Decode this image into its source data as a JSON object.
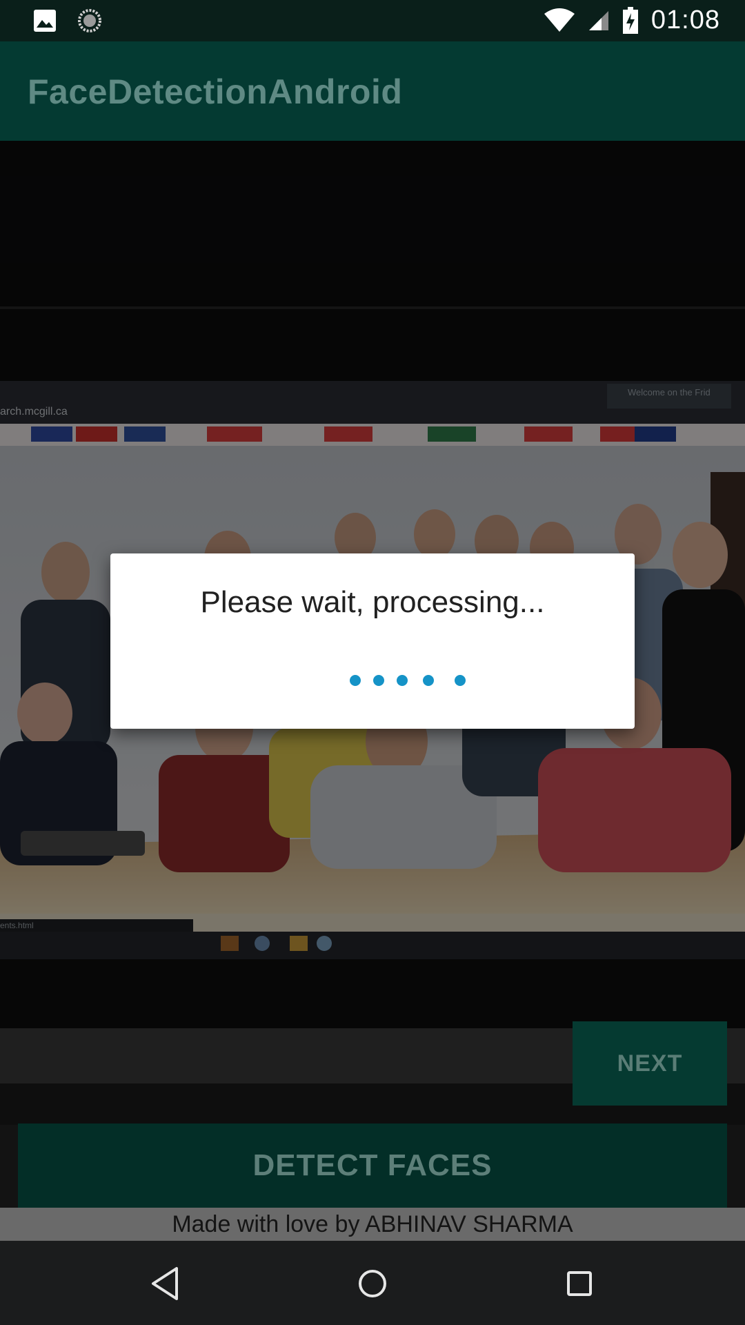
{
  "status_bar": {
    "time": "01:08",
    "left_icons": [
      "image-notification-icon",
      "sync-notification-icon"
    ],
    "right_icons": [
      "wifi-icon",
      "signal-icon",
      "battery-charging-icon"
    ]
  },
  "app_bar": {
    "title": "FaceDetectionAndroid"
  },
  "photo": {
    "url_text": "arch.mcgill.ca",
    "tab_text": "Welcome on the Frid",
    "status_text": "ents.html"
  },
  "buttons": {
    "next": "NEXT",
    "detect": "DETECT FACES"
  },
  "footer": {
    "text": "Made with love by ABHINAV SHARMA"
  },
  "dialog": {
    "message": "Please wait, processing..."
  },
  "colors": {
    "accent": "#1593c7",
    "primary_dark": "#043a32"
  },
  "nav_bar": {
    "icons": [
      "back-icon",
      "home-icon",
      "recents-icon"
    ]
  }
}
